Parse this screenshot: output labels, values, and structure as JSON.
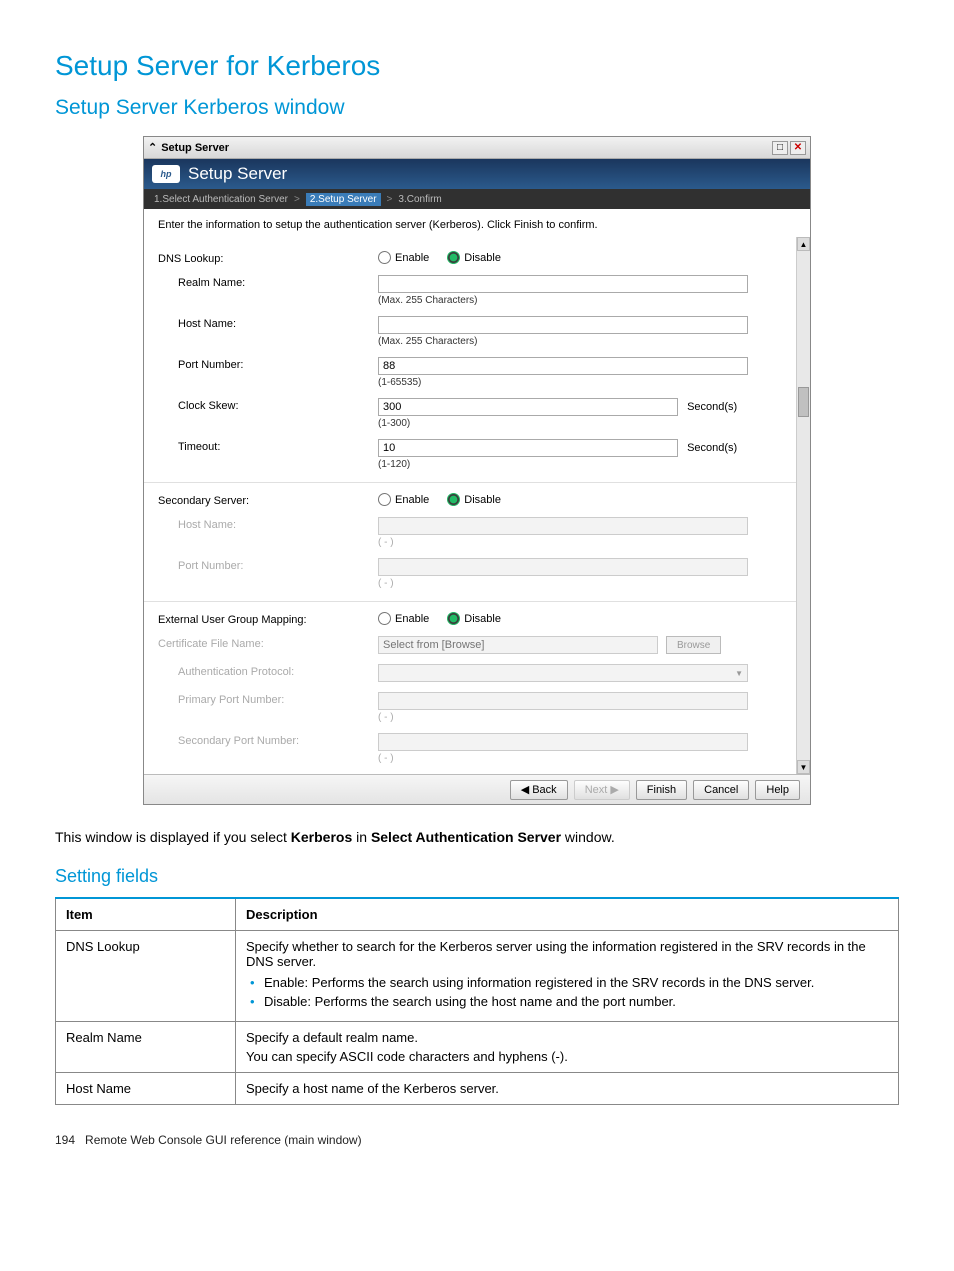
{
  "page": {
    "h1": "Setup Server for Kerberos",
    "h2": "Setup Server Kerberos window",
    "h3": "Setting fields",
    "caption_pre": "This window is displayed if you select ",
    "caption_b1": "Kerberos",
    "caption_mid": " in ",
    "caption_b2": "Select Authentication Server",
    "caption_post": " window.",
    "footer_pagenum": "194",
    "footer_text": "Remote Web Console GUI reference (main window)"
  },
  "window": {
    "titlebar": "Setup Server",
    "banner": "Setup Server",
    "wizard": {
      "step1": "1.Select Authentication Server",
      "step2": "2.Setup Server",
      "step3": "3.Confirm"
    },
    "instruction": "Enter the information to setup the authentication server (Kerberos). Click Finish to confirm.",
    "labels": {
      "dns": "DNS Lookup:",
      "realm": "Realm Name:",
      "host": "Host Name:",
      "port": "Port Number:",
      "clock": "Clock Skew:",
      "timeout": "Timeout:",
      "secondary": "Secondary Server:",
      "sec_host": "Host Name:",
      "sec_port": "Port Number:",
      "groupmap": "External User Group Mapping:",
      "cert": "Certificate File Name:",
      "authproto": "Authentication Protocol:",
      "pport": "Primary Port Number:",
      "sport": "Secondary Port Number:"
    },
    "radio": {
      "enable": "Enable",
      "disable": "Disable"
    },
    "hints": {
      "max255": "(Max. 255 Characters)",
      "portRange": "(1-65535)",
      "clockRange": "(1-300)",
      "timeoutRange": "(1-120)",
      "dash": "( - )"
    },
    "values": {
      "port": "88",
      "clock": "300",
      "timeout": "10",
      "seconds": "Second(s)",
      "cert_placeholder": "Select from [Browse]"
    },
    "buttons": {
      "browse": "Browse",
      "back": "Back",
      "next": "Next",
      "finish": "Finish",
      "cancel": "Cancel",
      "help": "Help"
    }
  },
  "table": {
    "head_item": "Item",
    "head_desc": "Description",
    "rows": [
      {
        "item": "DNS Lookup",
        "desc": "Specify whether to search for the Kerberos server using the information registered in the SRV records in the DNS server.",
        "bullets": [
          "Enable: Performs the search using information registered in the SRV records in the DNS server.",
          "Disable: Performs the search using the host name and the port number."
        ]
      },
      {
        "item": "Realm Name",
        "desc": "Specify a default realm name.",
        "desc2": "You can specify ASCII code characters and hyphens (-)."
      },
      {
        "item": "Host Name",
        "desc": "Specify a host name of the Kerberos server."
      }
    ]
  }
}
